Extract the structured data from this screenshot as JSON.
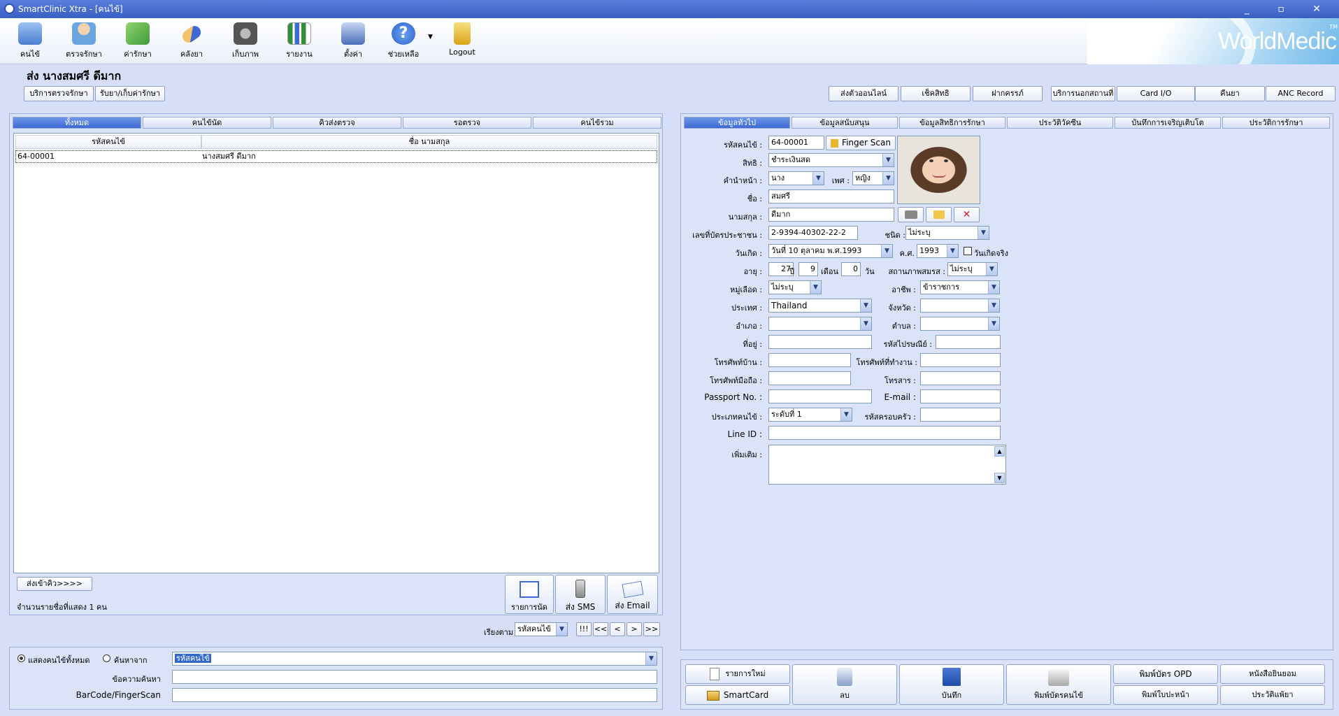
{
  "window": {
    "title": "SmartClinic Xtra - [คนไข้]",
    "controls": "_ ▫ ✕"
  },
  "toolbar": {
    "items": [
      {
        "label": "คนไข้",
        "icon": "patient-book-icon",
        "color": "#4a7fd1"
      },
      {
        "label": "ตรวจรักษา",
        "icon": "doctor-icon",
        "color": "#6aa5e0"
      },
      {
        "label": "ค่ารักษา",
        "icon": "money-icon",
        "color": "#3f9b3a"
      },
      {
        "label": "คลังยา",
        "icon": "capsule-icon",
        "color": "#e9932c"
      },
      {
        "label": "เก็บภาพ",
        "icon": "camera-icon",
        "color": "#555555"
      },
      {
        "label": "รายงาน",
        "icon": "bar-chart-icon",
        "color": "#2f8f3a"
      },
      {
        "label": "ตั้งค่า",
        "icon": "tools-icon",
        "color": "#4a6fb8"
      },
      {
        "label": "ช่วยเหลือ",
        "icon": "help-icon",
        "color": "#2a62c9"
      },
      {
        "label": "Logout",
        "icon": "lock-icon",
        "color": "#e0b020"
      }
    ],
    "logo": "WorldMedic",
    "logo_tm": "TM"
  },
  "patient_title": "ส่ง  นางสมศรี ดีมาก",
  "top_left_buttons": [
    "บริการตรวจรักษา",
    "รับยา/เก็บค่ารักษา"
  ],
  "top_right_buttons": [
    "ส่งตัวออนไลน์",
    "เช็คสิทธิ",
    "ฝากครรภ์",
    "บริการนอกสถานที่",
    "Card I/O",
    "คืนยา",
    "ANC Record"
  ],
  "left_tabs": [
    "ทั้งหมด",
    "คนไข้นัด",
    "คิวส่งตรวจ",
    "รอตรวจ",
    "คนไข้รวม"
  ],
  "patient_list": {
    "headers": [
      "รหัสคนไข้",
      "ชื่อ นามสกุล"
    ],
    "rows": [
      [
        "64-00001",
        "นางสมศรี ดีมาก"
      ]
    ]
  },
  "send_queue_button": "ส่งเข้าคิว>>>>",
  "list_count": "จำนวนรายชื่อที่แสดง 1 คน",
  "action_buttons": [
    "รายการนัด",
    "ส่ง SMS",
    "ส่ง Email"
  ],
  "sort": {
    "label": "เรียงตาม",
    "value": "รหัสคนไข้"
  },
  "nav_buttons": [
    "!!!",
    "<<",
    "<",
    ">",
    ">>"
  ],
  "search": {
    "radio_all": "แสดงคนไข้ทั้งหมด",
    "radio_search": "ค้นหาจาก",
    "search_by": "รหัสคนไข้",
    "query_label": "ข้อความค้นหา",
    "barcode_label": "BarCode/FingerScan"
  },
  "right_tabs": [
    "ข้อมูลทั่วไป",
    "ข้อมูลสนับสนุน",
    "ข้อมูลสิทธิการรักษา",
    "ประวัติวัคซีน",
    "บันทึกการเจริญเติบโต",
    "ประวัติการรักษา"
  ],
  "form": {
    "hn_label": "รหัสคนไข้ :",
    "hn": "64-00001",
    "finger_scan": "Finger Scan",
    "right_label": "สิทธิ :",
    "right": "ชำระเงินสด",
    "prefix_label": "คำนำหน้า :",
    "prefix": "นาง",
    "sex_label": "เพศ :",
    "sex": "หญิง",
    "first_label": "ชื่อ :",
    "first": "สมศรี",
    "last_label": "นามสกุล :",
    "last": "ดีมาก",
    "cid_label": "เลขที่บัตรประชาชน :",
    "cid": "2-9394-40302-22-2",
    "type_label": "ชนิด :",
    "type": "ไม่ระบุ",
    "dob_label": "วันเกิด :",
    "dob": "วันที่ 10   ตุลาคม   พ.ศ.1993",
    "ce_label": "ค.ศ.",
    "ce": "1993",
    "real_dob": "วันเกิดจริง",
    "age_label": "อายุ :",
    "age_y": "27",
    "year_unit": "ปี",
    "age_m": "9",
    "month_unit": "เดือน",
    "age_d": "0",
    "day_unit": "วัน",
    "marital_label": "สถานภาพสมรส :",
    "marital": "ไม่ระบุ",
    "blood_label": "หมู่เลือด :",
    "blood": "ไม่ระบุ",
    "occ_label": "อาชีพ :",
    "occ": "ข้าราชการ",
    "country_label": "ประเทศ :",
    "country": "Thailand",
    "province_label": "จังหวัด :",
    "district_label": "อำเภอ :",
    "subdistrict_label": "ตำบล :",
    "address_label": "ที่อยู่ :",
    "zip_label": "รหัสไปรษณีย์ :",
    "homephone_label": "โทรศัพท์บ้าน :",
    "workphone_label": "โทรศัพท์ที่ทำงาน :",
    "mobile_label": "โทรศัพท์มือถือ :",
    "fax_label": "โทรสาร :",
    "passport_label": "Passport No. :",
    "email_label": "E-mail :",
    "ptype_label": "ประเภทคนไข้ :",
    "ptype": "ระดับที่ 1",
    "family_label": "รหัสครอบครัว :",
    "line_label": "Line ID :",
    "more_label": "เพิ่มเติม :"
  },
  "bottom_buttons": {
    "new": "รายการใหม่",
    "smartcard": "SmartCard",
    "delete": "ลบ",
    "save": "บันทึก",
    "print_card": "พิมพ์บัตรคนไข้",
    "print_opd": "พิมพ์บัตร OPD",
    "consent": "หนังสือยินยอม",
    "print_appt": "พิมพ์ใบปะหน้า",
    "history": "ประวัติแพ้ยา"
  }
}
